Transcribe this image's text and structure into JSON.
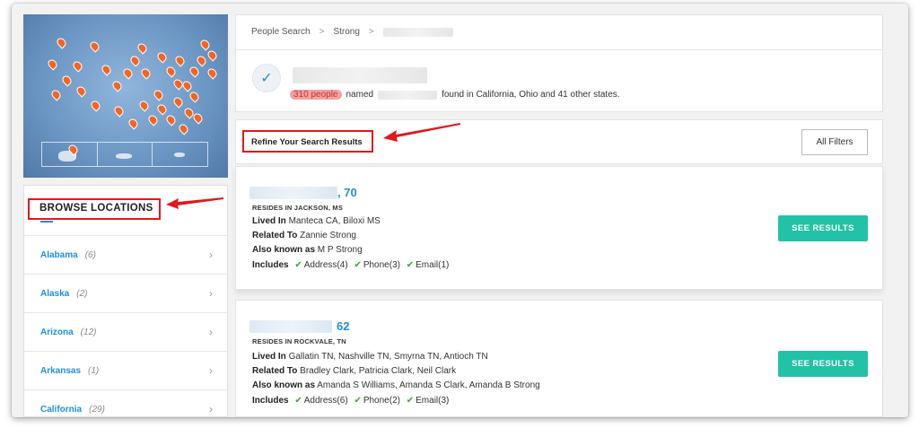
{
  "browse": {
    "title": "BROWSE LOCATIONS",
    "items": [
      {
        "name": "Alabama",
        "count": "(6)"
      },
      {
        "name": "Alaska",
        "count": "(2)"
      },
      {
        "name": "Arizona",
        "count": "(12)"
      },
      {
        "name": "Arkansas",
        "count": "(1)"
      },
      {
        "name": "California",
        "count": "(29)"
      }
    ]
  },
  "breadcrumb": {
    "items": [
      "People Search",
      "Strong"
    ],
    "separator": ">"
  },
  "summary": {
    "count": "310 people",
    "named": "named",
    "found": "found in California, Ohio and 41 other states."
  },
  "refine": {
    "label": "Refine Your Search Results",
    "filters_button": "All Filters"
  },
  "results": [
    {
      "age": ", 70",
      "resides": "RESIDES IN JACKSON, MS",
      "lived_in_label": "Lived In",
      "lived_in": "Manteca CA, Biloxi MS",
      "related_label": "Related To",
      "related": "Zannie Strong",
      "aka_label": "Also known as",
      "aka": "M P Strong",
      "includes_label": "Includes",
      "address": "Address(4)",
      "phone": "Phone(3)",
      "email": "Email(1)",
      "button": "SEE RESULTS"
    },
    {
      "age": "62",
      "resides": "RESIDES IN ROCKVALE, TN",
      "lived_in_label": "Lived In",
      "lived_in": "Gallatin TN, Nashville TN, Smyrna TN, Antioch TN",
      "related_label": "Related To",
      "related": "Bradley Clark, Patricia Clark, Neil Clark",
      "aka_label": "Also known as",
      "aka": "Amanda S Williams, Amanda S Clark, Amanda B Strong",
      "includes_label": "Includes",
      "address": "Address(6)",
      "phone": "Phone(2)",
      "email": "Email(3)",
      "button": "SEE RESULTS"
    }
  ],
  "colors": {
    "link_blue": "#1f8fd6",
    "button_teal": "#22c2a6",
    "pin_orange": "#f26522",
    "highlight_red": "#e0191b",
    "check_green": "#3aa335"
  },
  "icons": {
    "checkmark": "check-icon",
    "chevron": "chevron-right-icon",
    "map_pin": "map-pin-icon"
  }
}
